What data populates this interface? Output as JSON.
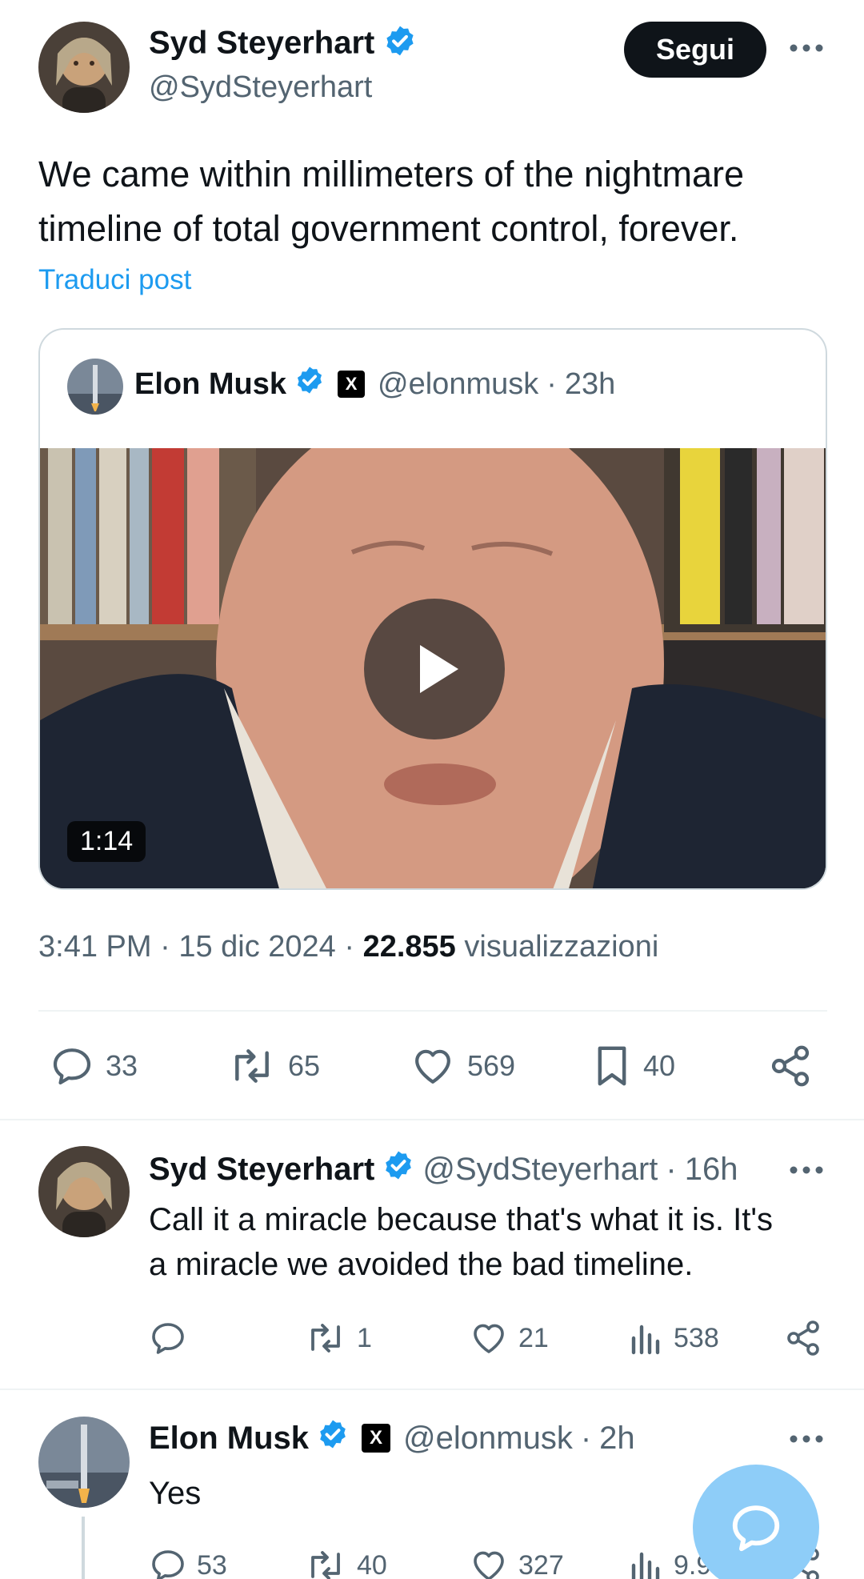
{
  "main_tweet": {
    "author_name": "Syd Steyerhart",
    "author_handle": "@SydSteyerhart",
    "follow_label": "Segui",
    "text_line1": "We came within millimeters of the nightmare",
    "text_line2": "timeline of total government control, forever.",
    "translate_label": "Traduci post",
    "time": "3:41 PM",
    "date": "15 dic 2024",
    "views_count": "22.855",
    "views_label": "visualizzazioni",
    "replies": "33",
    "reposts": "65",
    "likes": "569",
    "bookmarks": "40"
  },
  "quoted_tweet": {
    "author_name": "Elon Musk",
    "author_handle": "@elonmusk",
    "badge": "X",
    "age": "23h",
    "video_duration": "1:14"
  },
  "replies": [
    {
      "author_name": "Syd Steyerhart",
      "author_handle": "@SydSteyerhart",
      "age": "16h",
      "text_line1": "Call it a miracle because that's what it is. It's",
      "text_line2": "a miracle we avoided the bad timeline.",
      "replies": "",
      "reposts": "1",
      "likes": "21",
      "views": "538"
    },
    {
      "author_name": "Elon Musk",
      "author_handle": "@elonmusk",
      "badge": "X",
      "age": "2h",
      "text": "Yes",
      "replies": "53",
      "reposts": "40",
      "likes": "327",
      "views": "9.948"
    }
  ],
  "separator": "·",
  "colors": {
    "accent": "#1d9bf0",
    "text_primary": "#0f1419",
    "text_secondary": "#536471",
    "border": "#cfd9de",
    "fab": "#8ecdf8"
  },
  "icons": [
    "verified-badge-icon",
    "more-icon",
    "play-icon",
    "reply-icon",
    "repost-icon",
    "like-icon",
    "bookmark-icon",
    "share-icon",
    "views-icon",
    "compose-icon"
  ]
}
